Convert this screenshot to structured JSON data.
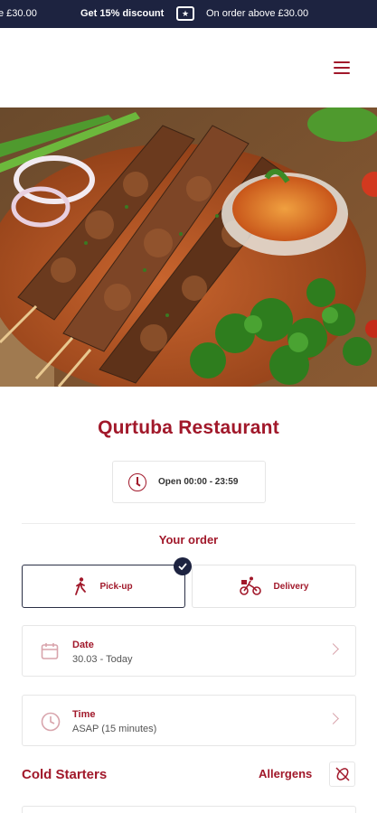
{
  "promo": {
    "text_left": "e £30.00",
    "discount": "Get 15% discount",
    "ticket_glyph": "★",
    "condition": "On order above £30.00"
  },
  "restaurant": {
    "name": "Qurtuba Restaurant",
    "hours": "Open 00:00 - 23:59"
  },
  "order": {
    "heading": "Your order",
    "modes": [
      {
        "label": "Pick-up",
        "icon": "walking-person-icon",
        "selected": true
      },
      {
        "label": "Delivery",
        "icon": "bicycle-courier-icon",
        "selected": false
      }
    ],
    "date": {
      "label": "Date",
      "value": "30.03 - Today",
      "icon": "calendar-icon"
    },
    "time": {
      "label": "Time",
      "value": "ASAP (15 minutes)",
      "icon": "clock-icon"
    }
  },
  "menu": {
    "section_title": "Cold Starters",
    "allergens_label": "Allergens"
  },
  "colors": {
    "brand": "#a1182a",
    "banner": "#1d2340"
  }
}
